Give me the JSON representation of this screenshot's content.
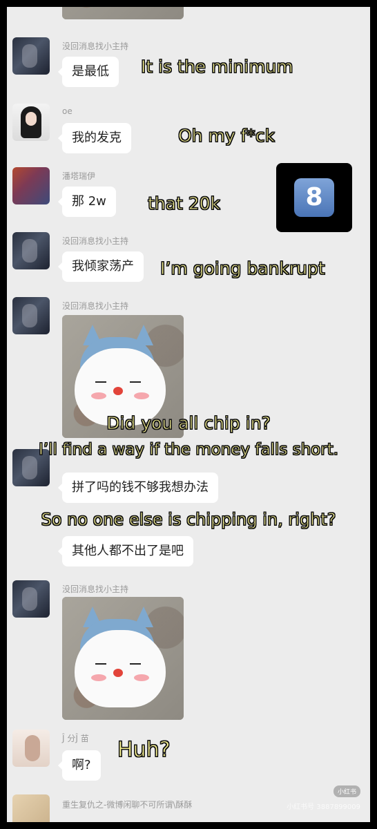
{
  "messages": [
    {
      "sender": "没回消息找小主持",
      "text": "是最低"
    },
    {
      "sender": "oe",
      "text": "我的发克"
    },
    {
      "sender": "潘塔瑞伊",
      "text": "那 2w"
    },
    {
      "sender": "没回消息找小主持",
      "text": "我倾家荡产"
    },
    {
      "sender": "没回消息找小主持",
      "sticker": "cat-sticker"
    },
    {
      "text": "拼了吗的钱不够我想办法"
    },
    {
      "text": "其他人都不出了是吧"
    },
    {
      "sender": "没回消息找小主持",
      "sticker": "cat-sticker"
    },
    {
      "sender": "Ĵ 分Ĵ 苗",
      "text": "啊?"
    },
    {
      "sender": "重生复仇之-微博闲聊不可所谓\\酥酥"
    }
  ],
  "captions": {
    "c1": "It is the minimum",
    "c2": "Oh my f*ck",
    "c3": "that 20k",
    "c4": "I’m going bankrupt",
    "c5": "Did you all chip in?",
    "c6": "I’ll find a way if the money falls short.",
    "c7": "So no one else is chipping in, right?",
    "c8": "Huh?"
  },
  "badge": {
    "label": "8",
    "icon": "keycap-eight-emoji"
  },
  "watermark": {
    "logo": "小红书",
    "id": "小红书号 3887899009"
  }
}
